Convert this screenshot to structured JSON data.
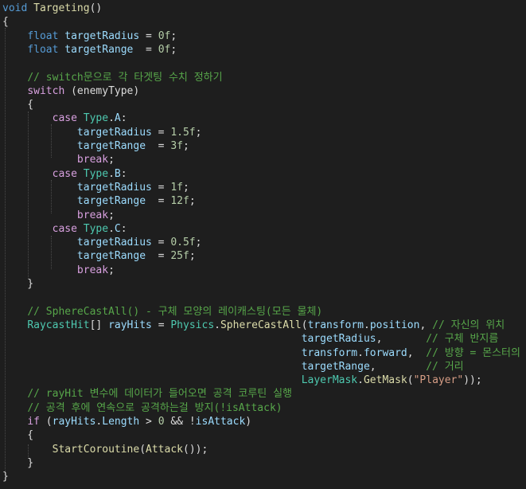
{
  "code": {
    "lines": [
      [
        {
          "t": "void",
          "c": "kw"
        },
        {
          "t": " ",
          "c": "op"
        },
        {
          "t": "Targeting",
          "c": "fn"
        },
        {
          "t": "()",
          "c": "op"
        }
      ],
      [
        {
          "t": "{",
          "c": "op"
        }
      ],
      [
        {
          "t": "    ",
          "c": "op"
        },
        {
          "t": "float",
          "c": "kw"
        },
        {
          "t": " ",
          "c": "op"
        },
        {
          "t": "targetRadius",
          "c": "id"
        },
        {
          "t": " = ",
          "c": "op"
        },
        {
          "t": "0f",
          "c": "num"
        },
        {
          "t": ";",
          "c": "op"
        }
      ],
      [
        {
          "t": "    ",
          "c": "op"
        },
        {
          "t": "float",
          "c": "kw"
        },
        {
          "t": " ",
          "c": "op"
        },
        {
          "t": "targetRange",
          "c": "id"
        },
        {
          "t": "  = ",
          "c": "op"
        },
        {
          "t": "0f",
          "c": "num"
        },
        {
          "t": ";",
          "c": "op"
        }
      ],
      [],
      [
        {
          "t": "    ",
          "c": "op"
        },
        {
          "t": "// switch문으로 각 타겟팅 수치 정하기",
          "c": "cm"
        }
      ],
      [
        {
          "t": "    ",
          "c": "op"
        },
        {
          "t": "switch",
          "c": "ctl"
        },
        {
          "t": " (enemyType)",
          "c": "op"
        }
      ],
      [
        {
          "t": "    {",
          "c": "op"
        }
      ],
      [
        {
          "t": "        ",
          "c": "op"
        },
        {
          "t": "case",
          "c": "ctl"
        },
        {
          "t": " ",
          "c": "op"
        },
        {
          "t": "Type",
          "c": "ty"
        },
        {
          "t": ".",
          "c": "op"
        },
        {
          "t": "A",
          "c": "id"
        },
        {
          "t": ":",
          "c": "op"
        }
      ],
      [
        {
          "t": "            ",
          "c": "op"
        },
        {
          "t": "targetRadius",
          "c": "id"
        },
        {
          "t": " = ",
          "c": "op"
        },
        {
          "t": "1.5f",
          "c": "num"
        },
        {
          "t": ";",
          "c": "op"
        }
      ],
      [
        {
          "t": "            ",
          "c": "op"
        },
        {
          "t": "targetRange",
          "c": "id"
        },
        {
          "t": "  = ",
          "c": "op"
        },
        {
          "t": "3f",
          "c": "num"
        },
        {
          "t": ";",
          "c": "op"
        }
      ],
      [
        {
          "t": "            ",
          "c": "op"
        },
        {
          "t": "break",
          "c": "ctl"
        },
        {
          "t": ";",
          "c": "op"
        }
      ],
      [
        {
          "t": "        ",
          "c": "op"
        },
        {
          "t": "case",
          "c": "ctl"
        },
        {
          "t": " ",
          "c": "op"
        },
        {
          "t": "Type",
          "c": "ty"
        },
        {
          "t": ".",
          "c": "op"
        },
        {
          "t": "B",
          "c": "id"
        },
        {
          "t": ":",
          "c": "op"
        }
      ],
      [
        {
          "t": "            ",
          "c": "op"
        },
        {
          "t": "targetRadius",
          "c": "id"
        },
        {
          "t": " = ",
          "c": "op"
        },
        {
          "t": "1f",
          "c": "num"
        },
        {
          "t": ";",
          "c": "op"
        }
      ],
      [
        {
          "t": "            ",
          "c": "op"
        },
        {
          "t": "targetRange",
          "c": "id"
        },
        {
          "t": "  = ",
          "c": "op"
        },
        {
          "t": "12f",
          "c": "num"
        },
        {
          "t": ";",
          "c": "op"
        }
      ],
      [
        {
          "t": "            ",
          "c": "op"
        },
        {
          "t": "break",
          "c": "ctl"
        },
        {
          "t": ";",
          "c": "op"
        }
      ],
      [
        {
          "t": "        ",
          "c": "op"
        },
        {
          "t": "case",
          "c": "ctl"
        },
        {
          "t": " ",
          "c": "op"
        },
        {
          "t": "Type",
          "c": "ty"
        },
        {
          "t": ".",
          "c": "op"
        },
        {
          "t": "C",
          "c": "id"
        },
        {
          "t": ":",
          "c": "op"
        }
      ],
      [
        {
          "t": "            ",
          "c": "op"
        },
        {
          "t": "targetRadius",
          "c": "id"
        },
        {
          "t": " = ",
          "c": "op"
        },
        {
          "t": "0.5f",
          "c": "num"
        },
        {
          "t": ";",
          "c": "op"
        }
      ],
      [
        {
          "t": "            ",
          "c": "op"
        },
        {
          "t": "targetRange",
          "c": "id"
        },
        {
          "t": "  = ",
          "c": "op"
        },
        {
          "t": "25f",
          "c": "num"
        },
        {
          "t": ";",
          "c": "op"
        }
      ],
      [
        {
          "t": "            ",
          "c": "op"
        },
        {
          "t": "break",
          "c": "ctl"
        },
        {
          "t": ";",
          "c": "op"
        }
      ],
      [
        {
          "t": "    }",
          "c": "op"
        }
      ],
      [],
      [
        {
          "t": "    ",
          "c": "op"
        },
        {
          "t": "// SphereCastAll() - 구체 모양의 레이캐스팅(모든 물체)",
          "c": "cm"
        }
      ],
      [
        {
          "t": "    ",
          "c": "op"
        },
        {
          "t": "RaycastHit",
          "c": "ty"
        },
        {
          "t": "[] ",
          "c": "op"
        },
        {
          "t": "rayHits",
          "c": "id"
        },
        {
          "t": " = ",
          "c": "op"
        },
        {
          "t": "Physics",
          "c": "ty"
        },
        {
          "t": ".",
          "c": "op"
        },
        {
          "t": "SphereCastAll",
          "c": "fn"
        },
        {
          "t": "(",
          "c": "op"
        },
        {
          "t": "transform",
          "c": "id"
        },
        {
          "t": ".",
          "c": "op"
        },
        {
          "t": "position",
          "c": "id"
        },
        {
          "t": ", ",
          "c": "op"
        },
        {
          "t": "// 자신의 위치",
          "c": "cm"
        }
      ],
      [
        {
          "t": "                                                ",
          "c": "op"
        },
        {
          "t": "targetRadius",
          "c": "id"
        },
        {
          "t": ",       ",
          "c": "op"
        },
        {
          "t": "// 구체 반지름",
          "c": "cm"
        }
      ],
      [
        {
          "t": "                                                ",
          "c": "op"
        },
        {
          "t": "transform",
          "c": "id"
        },
        {
          "t": ".",
          "c": "op"
        },
        {
          "t": "forward",
          "c": "id"
        },
        {
          "t": ",  ",
          "c": "op"
        },
        {
          "t": "// 방향 = 몬스터의 앞",
          "c": "cm"
        }
      ],
      [
        {
          "t": "                                                ",
          "c": "op"
        },
        {
          "t": "targetRange",
          "c": "id"
        },
        {
          "t": ",        ",
          "c": "op"
        },
        {
          "t": "// 거리",
          "c": "cm"
        }
      ],
      [
        {
          "t": "                                                ",
          "c": "op"
        },
        {
          "t": "LayerMask",
          "c": "ty"
        },
        {
          "t": ".",
          "c": "op"
        },
        {
          "t": "GetMask",
          "c": "fn"
        },
        {
          "t": "(",
          "c": "op"
        },
        {
          "t": "\"Player\"",
          "c": "str"
        },
        {
          "t": "));",
          "c": "op"
        }
      ],
      [
        {
          "t": "    ",
          "c": "op"
        },
        {
          "t": "// rayHit 변수에 데이터가 들어오면 공격 코루틴 실행",
          "c": "cm"
        }
      ],
      [
        {
          "t": "    ",
          "c": "op"
        },
        {
          "t": "// 공격 후에 연속으로 공격하는걸 방지(!isAttack)",
          "c": "cm"
        }
      ],
      [
        {
          "t": "    ",
          "c": "op"
        },
        {
          "t": "if",
          "c": "ctl"
        },
        {
          "t": " (",
          "c": "op"
        },
        {
          "t": "rayHits",
          "c": "id"
        },
        {
          "t": ".",
          "c": "op"
        },
        {
          "t": "Length",
          "c": "id"
        },
        {
          "t": " > ",
          "c": "op"
        },
        {
          "t": "0",
          "c": "num"
        },
        {
          "t": " && !",
          "c": "op"
        },
        {
          "t": "isAttack",
          "c": "id"
        },
        {
          "t": ")",
          "c": "op"
        }
      ],
      [
        {
          "t": "    {",
          "c": "op"
        }
      ],
      [
        {
          "t": "        ",
          "c": "op"
        },
        {
          "t": "StartCoroutine",
          "c": "fn"
        },
        {
          "t": "(",
          "c": "op"
        },
        {
          "t": "Attack",
          "c": "fn"
        },
        {
          "t": "());",
          "c": "op"
        }
      ],
      [
        {
          "t": "    }",
          "c": "op"
        }
      ],
      [
        {
          "t": "}",
          "c": "op"
        }
      ]
    ]
  }
}
